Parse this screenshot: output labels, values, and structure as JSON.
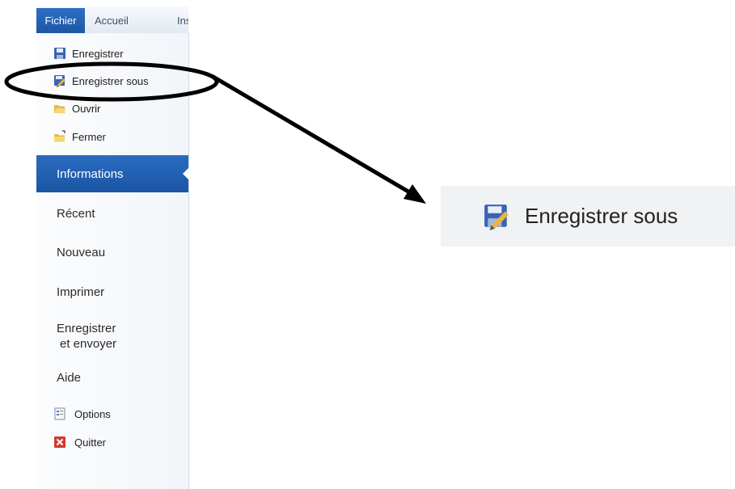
{
  "ribbon": {
    "tabs": [
      {
        "label": "Fichier"
      },
      {
        "label": "Accueil"
      },
      {
        "label": "Ins"
      }
    ]
  },
  "backstage": {
    "commands": [
      {
        "label": "Enregistrer",
        "icon": "save-icon"
      },
      {
        "label": "Enregistrer sous",
        "icon": "save-as-icon"
      },
      {
        "label": "Ouvrir",
        "icon": "open-folder-icon"
      },
      {
        "label": "Fermer",
        "icon": "close-folder-icon"
      }
    ],
    "selected": "Informations",
    "items": [
      {
        "label": "Récent"
      },
      {
        "label": "Nouveau"
      },
      {
        "label": "Imprimer"
      },
      {
        "line1": "Enregistrer",
        "line2": "et envoyer"
      },
      {
        "label": "Aide"
      }
    ],
    "footer": [
      {
        "label": "Options",
        "icon": "options-icon"
      },
      {
        "label": "Quitter",
        "icon": "exit-icon"
      }
    ]
  },
  "zoom_callout": {
    "label": "Enregistrer sous",
    "icon": "save-as-icon"
  },
  "colors": {
    "accent": "#1d56a5",
    "annotation": "#000000"
  }
}
